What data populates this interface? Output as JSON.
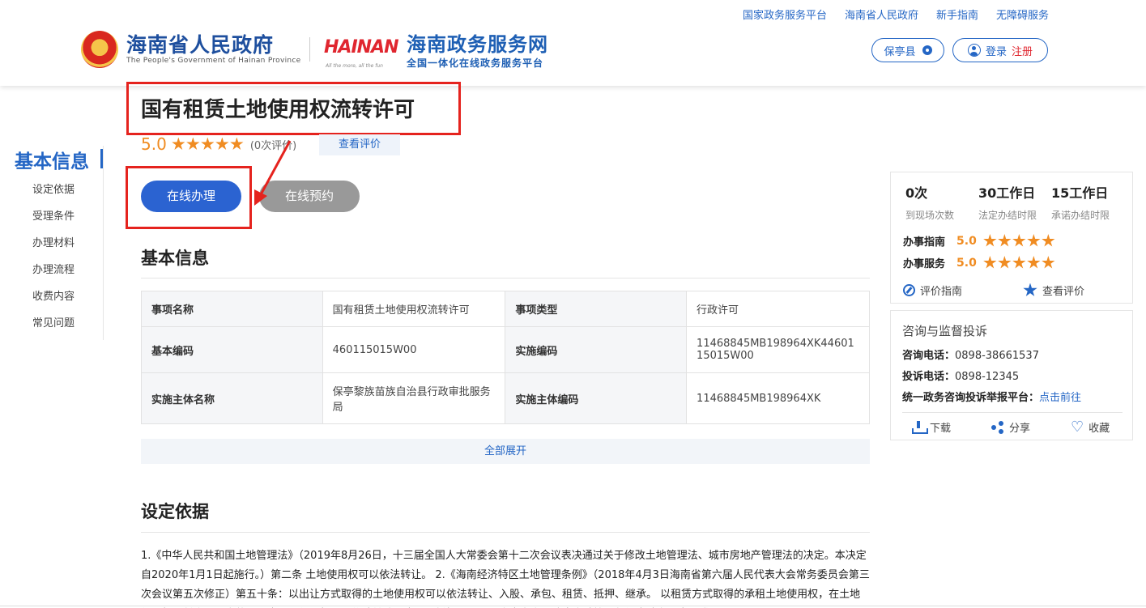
{
  "top_links": [
    "国家政务服务平台",
    "海南省人民政府",
    "新手指南",
    "无障碍服务"
  ],
  "logo": {
    "gov_name": "海南省人民政府",
    "gov_en": "The People's Government of Hainan Province",
    "hainan_mark": "HAINAN",
    "hainan_slogan": "All the more, all the fun",
    "portal_name": "海南政务服务网",
    "portal_sub": "全国一体化在线政务服务平台"
  },
  "region": "保亭县",
  "auth": {
    "login": "登录",
    "register": "注册"
  },
  "left_nav": {
    "title": "基本信息",
    "items": [
      "设定依据",
      "受理条件",
      "办理材料",
      "办理流程",
      "收费内容",
      "常见问题"
    ]
  },
  "item": {
    "title": "国有租赁土地使用权流转许可",
    "score": "5.0",
    "review_count": "(0次评价)",
    "view_review": "查看评价",
    "btn_online": "在线办理",
    "btn_appoint": "在线预约"
  },
  "basic_info": {
    "title": "基本信息",
    "rows": [
      {
        "k1": "事项名称",
        "v1": "国有租赁土地使用权流转许可",
        "k2": "事项类型",
        "v2": "行政许可"
      },
      {
        "k1": "基本编码",
        "v1": "460115015W00",
        "k2": "实施编码",
        "v2": "11468845MB198964XK4460115015W00"
      },
      {
        "k1": "实施主体名称",
        "v1": "保亭黎族苗族自治县行政审批服务局",
        "k2": "实施主体编码",
        "v2": "11468845MB198964XK"
      }
    ],
    "expand": "全部展开"
  },
  "basis": {
    "title": "设定依据",
    "text": "1.《中华人民共和国土地管理法》（2019年8月26日，十三届全国人大常委会第十二次会议表决通过关于修改土地管理法、城市房地产管理法的决定。本决定自2020年1月1日起施行。）第二条 土地使用权可以依法转让。 2.《海南经济特区土地管理条例》（2018年4月3日海南省第六届人民代表大会常务委员会第三次会议第五次修正）第五十条：以出让方式取得的土地使用权可以依法转让、入股、承包、租赁、抵押、继承。 以租赁方式取得的承租土地使用权，在土地使用权租赁合同规定的期限内，其使用权可以依法转让、出租、抵押，承租人应当向市县政府土地管理部门申请办理变更登记。"
  },
  "right_stats": [
    {
      "num": "0次",
      "lbl": "到现场次数"
    },
    {
      "num": "30工作日",
      "lbl": "法定办结时限"
    },
    {
      "num": "15工作日",
      "lbl": "承诺办结时限"
    }
  ],
  "right_ratings": [
    {
      "label": "办事指南",
      "score": "5.0"
    },
    {
      "label": "办事服务",
      "score": "5.0"
    }
  ],
  "right_links": {
    "guide": "评价指南",
    "view": "查看评价"
  },
  "contact": {
    "title": "咨询与监督投诉",
    "consult_label": "咨询电话：",
    "consult_value": "0898-38661537",
    "complain_label": "投诉电话：",
    "complain_value": "0898-12345",
    "platform_label": "统一政务咨询投诉举报平台：",
    "platform_link": "点击前往"
  },
  "actions": {
    "download": "下载",
    "share": "分享",
    "favorite": "收藏"
  },
  "colors": {
    "primary": "#2466c5",
    "accent_red": "#e5231e",
    "star": "#f08c22",
    "button": "#2b63d1"
  }
}
